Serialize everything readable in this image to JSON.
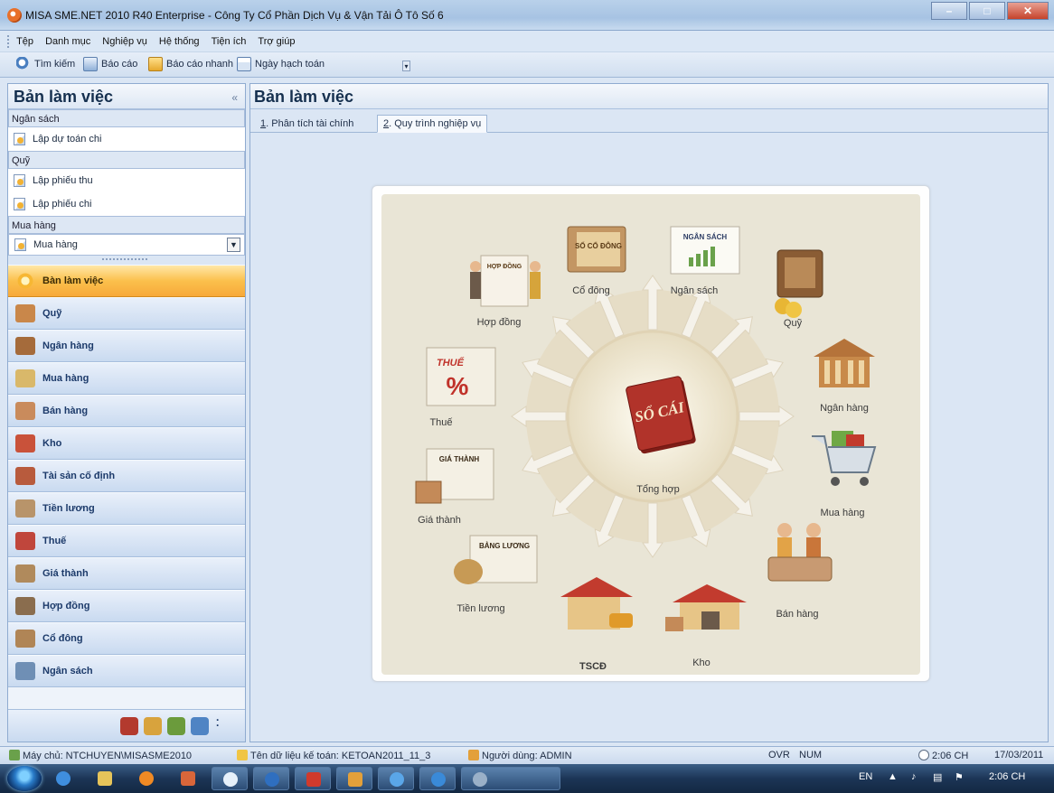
{
  "window": {
    "title": "MISA SME.NET 2010 R40 Enterprise - Công Ty Cổ Phần Dịch Vụ & Vận Tải Ô Tô Số 6"
  },
  "menu": [
    "Tệp",
    "Danh mục",
    "Nghiệp vụ",
    "Hệ thống",
    "Tiện ích",
    "Trợ giúp"
  ],
  "toolbar": {
    "search": "Tìm kiếm",
    "report": "Báo cáo",
    "quick_report": "Báo cáo nhanh",
    "posting_date": "Ngày hạch toán"
  },
  "left_panel": {
    "title": "Bản làm việc",
    "collapse_glyph": "«",
    "sections": [
      {
        "label": "Ngân sách",
        "items": [
          "Lập dự toán chi"
        ]
      },
      {
        "label": "Quỹ",
        "items": [
          "Lập phiếu thu",
          "Lập phiếu chi"
        ]
      },
      {
        "label": "Mua hàng"
      }
    ],
    "combo_value": "Mua hàng",
    "nav": [
      {
        "label": "Bàn làm việc",
        "color": "#f4b544"
      },
      {
        "label": "Quỹ",
        "color": "#c9874a"
      },
      {
        "label": "Ngân hàng",
        "color": "#a56b3b"
      },
      {
        "label": "Mua hàng",
        "color": "#d9b86a"
      },
      {
        "label": "Bán hàng",
        "color": "#c98b5c"
      },
      {
        "label": "Kho",
        "color": "#c9523a"
      },
      {
        "label": "Tài sản cố định",
        "color": "#b85b3d"
      },
      {
        "label": "Tiền lương",
        "color": "#b8946a"
      },
      {
        "label": "Thuế",
        "color": "#c0463c"
      },
      {
        "label": "Giá thành",
        "color": "#b08a5c"
      },
      {
        "label": "Hợp đồng",
        "color": "#8a6d4e"
      },
      {
        "label": "Cổ đông",
        "color": "#b08556"
      },
      {
        "label": "Ngân sách",
        "color": "#6f8fb5"
      }
    ]
  },
  "workspace": {
    "title": "Bản làm việc",
    "tabs": [
      {
        "num": "1",
        "label": ". Phân tích tài chính"
      },
      {
        "num": "2",
        "label": ". Quy trình nghiệp vụ"
      }
    ],
    "diagram": {
      "center": "Tổng hợp",
      "center_book_text": "SỔ CÁI",
      "modules": [
        "Cổ đông",
        "Ngân sách",
        "Quỹ",
        "Hợp đồng",
        "Ngân hàng",
        "Thuế",
        "Mua hàng",
        "Giá thành",
        "Bán hàng",
        "Tiền lương",
        "TSCĐ",
        "Kho"
      ],
      "book_texts": {
        "co_dong": "SỐ CỔ ĐÔNG",
        "ngan_sach": "NGÂN SÁCH",
        "hop_dong": "HỢP ĐỒNG",
        "thue": "THUẾ",
        "thue_symbol": "%",
        "gia_thanh": "GIÁ THÀNH",
        "bang_luong": "BẢNG LƯƠNG"
      }
    }
  },
  "status": {
    "server": "Máy chủ: NTCHUYEN\\MISASME2010",
    "db": "Tên dữ liệu kế toán: KETOAN2011_11_3",
    "user": "Người dùng: ADMIN",
    "ovr": "OVR",
    "num": "NUM",
    "time": "2:06 CH",
    "date": "17/03/2011"
  },
  "taskbar": {
    "lang": "EN",
    "clock": "2:06 CH"
  }
}
